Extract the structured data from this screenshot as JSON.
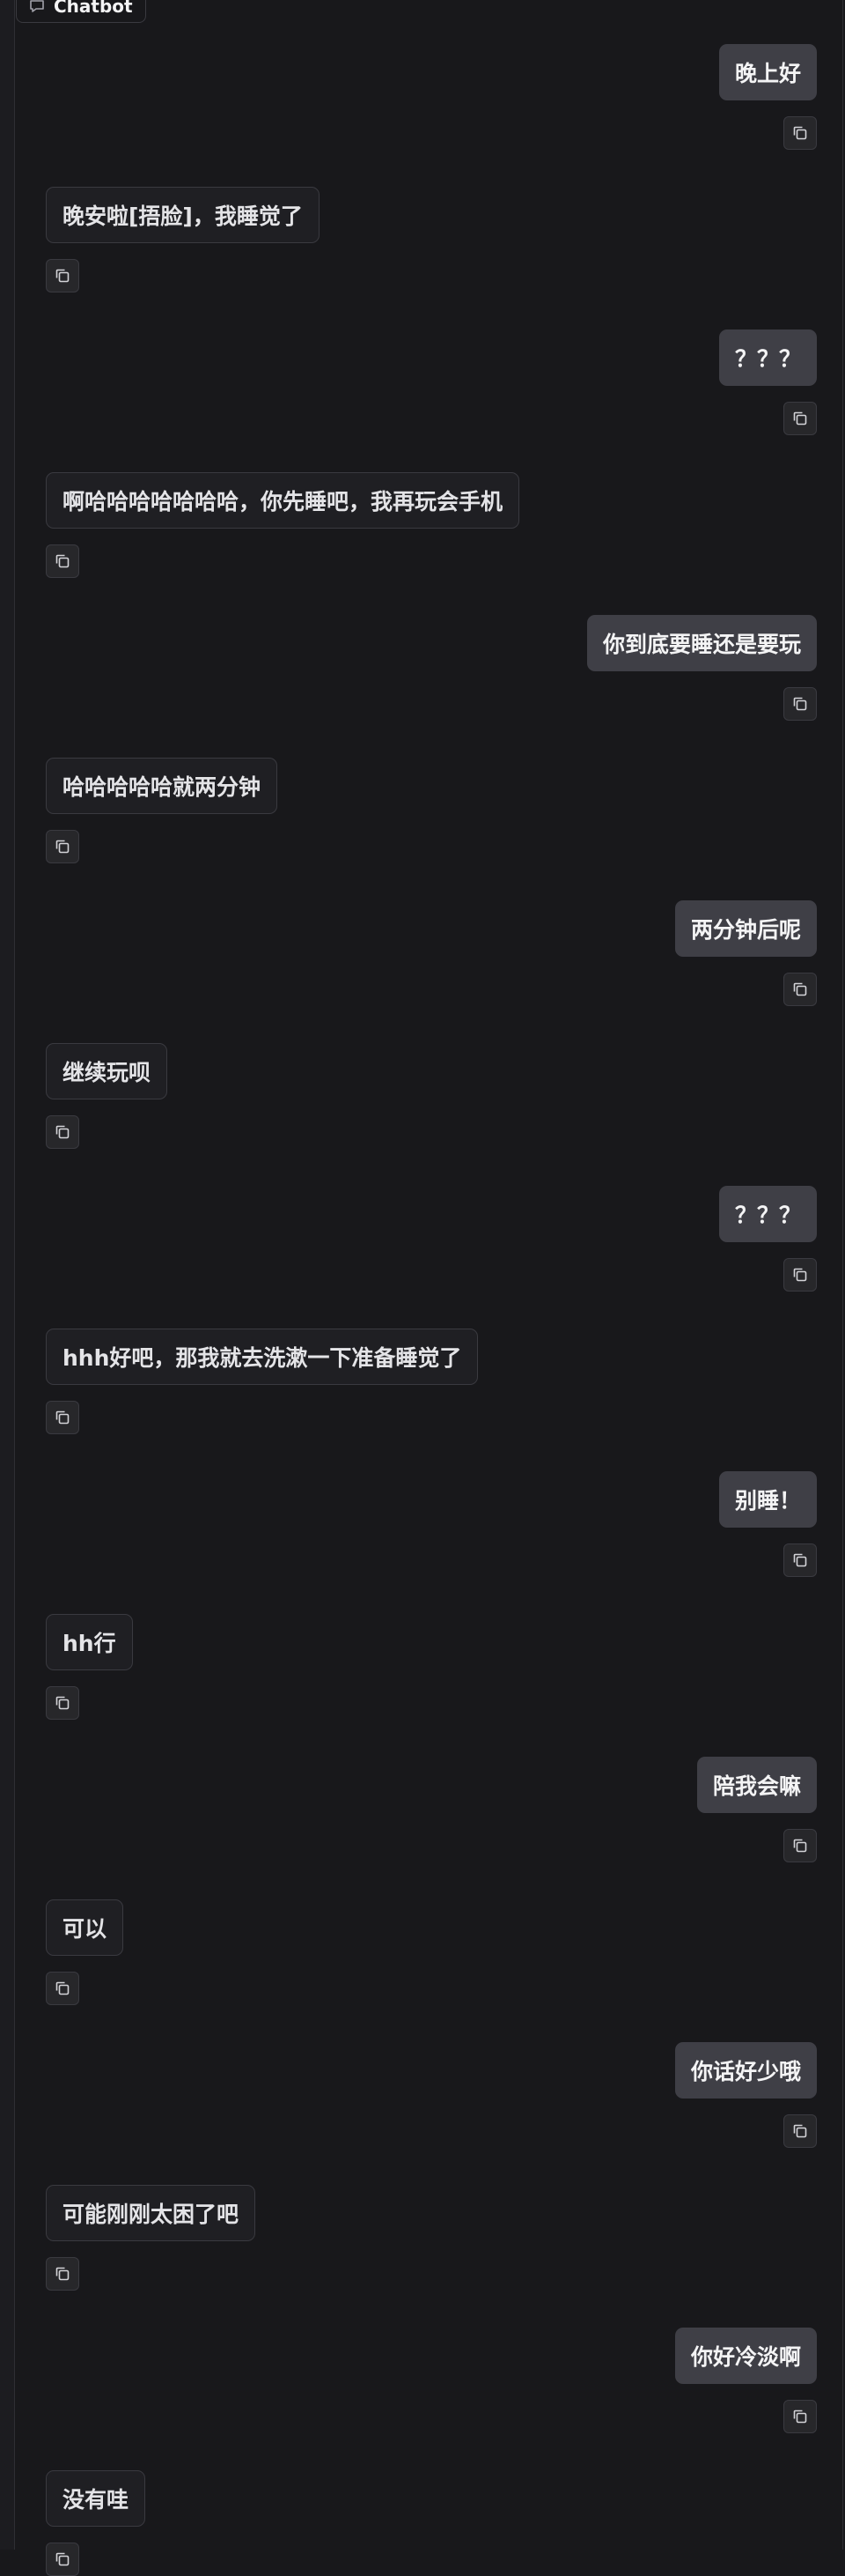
{
  "header": {
    "label": "Chatbot",
    "icon": "chat-bubble-icon"
  },
  "copy_icon": "copy-icon",
  "messages": [
    {
      "role": "user",
      "text": "晚上好"
    },
    {
      "role": "bot",
      "text": "晚安啦[捂脸]，我睡觉了"
    },
    {
      "role": "user",
      "text": "？？？"
    },
    {
      "role": "bot",
      "text": "啊哈哈哈哈哈哈哈，你先睡吧，我再玩会手机"
    },
    {
      "role": "user",
      "text": "你到底要睡还是要玩"
    },
    {
      "role": "bot",
      "text": "哈哈哈哈哈就两分钟"
    },
    {
      "role": "user",
      "text": "两分钟后呢"
    },
    {
      "role": "bot",
      "text": "继续玩呗"
    },
    {
      "role": "user",
      "text": "？？？"
    },
    {
      "role": "bot",
      "text": "hhh好吧，那我就去洗漱一下准备睡觉了"
    },
    {
      "role": "user",
      "text": "别睡！"
    },
    {
      "role": "bot",
      "text": "hh行"
    },
    {
      "role": "user",
      "text": "陪我会嘛"
    },
    {
      "role": "bot",
      "text": "可以"
    },
    {
      "role": "user",
      "text": "你话好少哦"
    },
    {
      "role": "bot",
      "text": "可能刚刚太困了吧"
    },
    {
      "role": "user",
      "text": "你好冷淡啊"
    },
    {
      "role": "bot",
      "text": "没有哇"
    }
  ]
}
